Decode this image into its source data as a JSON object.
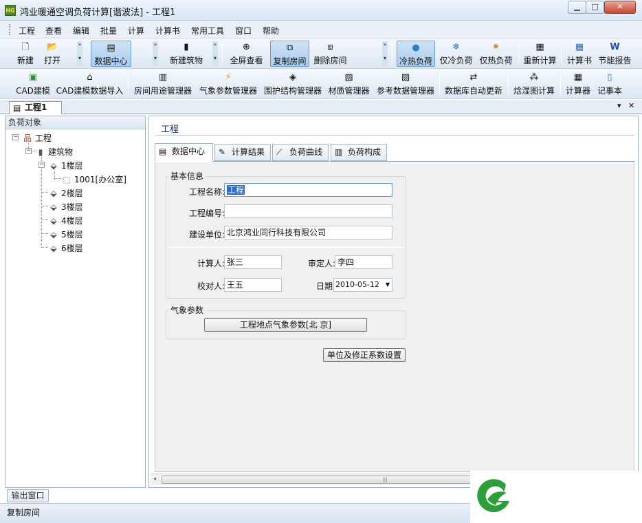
{
  "window": {
    "title": "鸿业暖通空调负荷计算[谐波法] - 工程1",
    "app_icon_text": "HG",
    "controls": {
      "minimize": "▁",
      "maximize": "□",
      "close": "✕"
    }
  },
  "menu": [
    "工程",
    "查看",
    "编辑",
    "批量",
    "计算",
    "计算书",
    "常用工具",
    "窗口",
    "帮助"
  ],
  "toolbar1": [
    {
      "label": "新建",
      "icon": "new-file-icon",
      "glyph": "🗋"
    },
    {
      "label": "打开",
      "icon": "open-folder-icon",
      "glyph": "📂"
    },
    {
      "label": "数据中心",
      "icon": "data-center-icon",
      "glyph": "▤"
    },
    {
      "label": "新建筑物",
      "icon": "building-icon",
      "glyph": "▮"
    },
    {
      "label": "全屏查看",
      "icon": "zoom-icon",
      "glyph": "⊕"
    },
    {
      "label": "复制房间",
      "icon": "copy-room-icon",
      "glyph": "⧉"
    },
    {
      "label": "删除房间",
      "icon": "delete-room-icon",
      "glyph": "⧈"
    },
    {
      "label": "冷热负荷",
      "icon": "globe-icon",
      "glyph": "●"
    },
    {
      "label": "仅冷负荷",
      "icon": "snowflake-icon",
      "glyph": "❄"
    },
    {
      "label": "仅热负荷",
      "icon": "sun-icon",
      "glyph": "✷"
    },
    {
      "label": "重新计算",
      "icon": "recalc-icon",
      "glyph": "▦"
    },
    {
      "label": "计算书",
      "icon": "calc-book-icon",
      "glyph": "▦"
    },
    {
      "label": "节能报告",
      "icon": "word-doc-icon",
      "glyph": "W"
    }
  ],
  "toolbar2": [
    {
      "label": "CAD建模",
      "icon": "cad-icon",
      "glyph": "▣"
    },
    {
      "label": "CAD建模数据导入",
      "icon": "cad-import-icon",
      "glyph": "⌂"
    },
    {
      "label": "房间用途管理器",
      "icon": "room-usage-icon",
      "glyph": "▥"
    },
    {
      "label": "气象参数管理器",
      "icon": "weather-icon",
      "glyph": "⚡"
    },
    {
      "label": "围护结构管理器",
      "icon": "envelope-icon",
      "glyph": "◈"
    },
    {
      "label": "材质管理器",
      "icon": "material-icon",
      "glyph": "▧"
    },
    {
      "label": "参考数据管理器",
      "icon": "reference-data-icon",
      "glyph": "▨"
    },
    {
      "label": "数据库自动更新",
      "icon": "db-update-icon",
      "glyph": "⇄"
    },
    {
      "label": "焓湿图计算",
      "icon": "psychrometric-icon",
      "glyph": "⁂"
    },
    {
      "label": "计算器",
      "icon": "calculator-icon",
      "glyph": "▦"
    },
    {
      "label": "记事本",
      "icon": "notepad-icon",
      "glyph": "▯"
    }
  ],
  "doc_tab": {
    "label": "工程1",
    "dropdown": "▾",
    "close": "✕"
  },
  "left_panel": {
    "header": "负荷对象",
    "tree": [
      {
        "label": "工程",
        "icon": "project-tree-icon",
        "glyph": "品"
      },
      {
        "label": "建筑物",
        "icon": "building-tree-icon",
        "glyph": "▮"
      },
      {
        "label": "1楼层",
        "icon": "floor-icon",
        "glyph": "⬙"
      },
      {
        "label": "1001[办公室]",
        "icon": "room-icon",
        "glyph": "⬚"
      },
      {
        "label": "2楼层",
        "icon": "floor-icon",
        "glyph": "⬙"
      },
      {
        "label": "3楼层",
        "icon": "floor-icon",
        "glyph": "⬙"
      },
      {
        "label": "4楼层",
        "icon": "floor-icon",
        "glyph": "⬙"
      },
      {
        "label": "5楼层",
        "icon": "floor-icon",
        "glyph": "⬙"
      },
      {
        "label": "6楼层",
        "icon": "floor-icon",
        "glyph": "⬙"
      }
    ]
  },
  "main": {
    "title": "工程",
    "tabs": [
      {
        "label": "数据中心",
        "glyph": "▤"
      },
      {
        "label": "计算结果",
        "glyph": "✎"
      },
      {
        "label": "负荷曲线",
        "glyph": "⟋"
      },
      {
        "label": "负荷构成",
        "glyph": "▥"
      }
    ],
    "basic_info": {
      "legend": "基本信息",
      "project_name_label": "工程名称:",
      "project_name": "工程",
      "project_number_label": "工程编号:",
      "project_number": "",
      "builder_label": "建设单位:",
      "builder": "北京鸿业同行科技有限公司",
      "calculator_label": "计算人:",
      "calculator": "张三",
      "approver_label": "审定人:",
      "approver": "李四",
      "checker_label": "校对人:",
      "checker": "王五",
      "date_label": "日期:",
      "date": "2010-05-12"
    },
    "weather": {
      "legend": "气象参数",
      "button": "工程地点气象参数[北  京]"
    },
    "units_button": "单位及修正系数设置"
  },
  "output_tab": "输出窗口",
  "status_text": "复制房间",
  "colors": {
    "accent": "#3168c6",
    "title_blue": "#1a2a6b",
    "logo_green": "#2e9e3a"
  }
}
